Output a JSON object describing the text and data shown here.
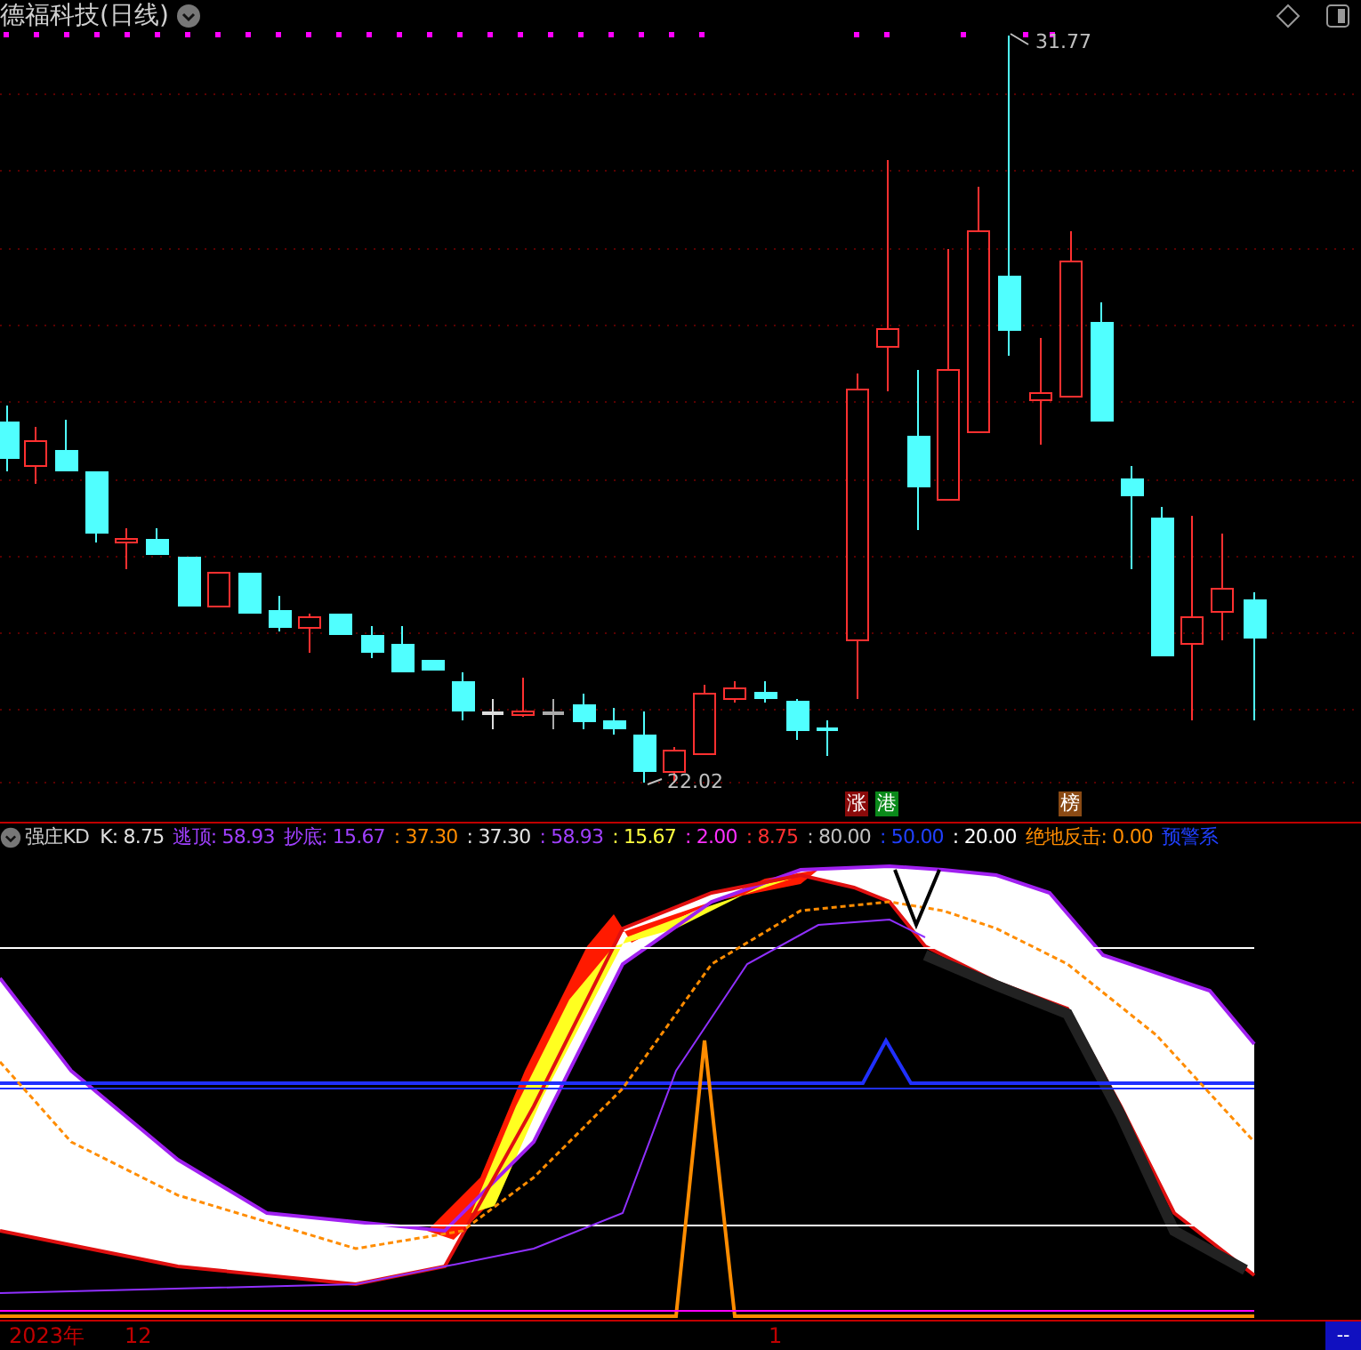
{
  "title": "德福科技(日线)",
  "price_chart": {
    "high_label": "31.77",
    "low_label": "22.02"
  },
  "badges": [
    {
      "text": "涨",
      "color": "#8b0a0a"
    },
    {
      "text": "港",
      "color": "#0a8a1a"
    },
    {
      "text": "榜",
      "color": "#8a4a14"
    }
  ],
  "indicator": {
    "name": "强庄KD",
    "readouts": [
      {
        "text": "K: 8.75",
        "color": "#e0e0e0"
      },
      {
        "text": "逃顶: 58.93",
        "color": "#a040ff"
      },
      {
        "text": "抄底: 15.67",
        "color": "#a040ff"
      },
      {
        "text": ": 37.30",
        "color": "#ff8c00"
      },
      {
        "text": ": 37.30",
        "color": "#e0e0e0"
      },
      {
        "text": ": 58.93",
        "color": "#a040ff"
      },
      {
        "text": ": 15.67",
        "color": "#ffff40"
      },
      {
        "text": ": 2.00",
        "color": "#ff30ff"
      },
      {
        "text": ": 8.75",
        "color": "#ff3030"
      },
      {
        "text": ": 80.00",
        "color": "#c0c0c0"
      },
      {
        "text": ": 50.00",
        "color": "#2040ff"
      },
      {
        "text": ": 20.00",
        "color": "#ffffff"
      },
      {
        "text": "绝地反击: 0.00",
        "color": "#ff8c00"
      },
      {
        "text": "预警系",
        "color": "#2040ff"
      }
    ]
  },
  "x_axis": {
    "labels": [
      "2023年",
      "12",
      "1"
    ],
    "corner_button": "--"
  }
}
